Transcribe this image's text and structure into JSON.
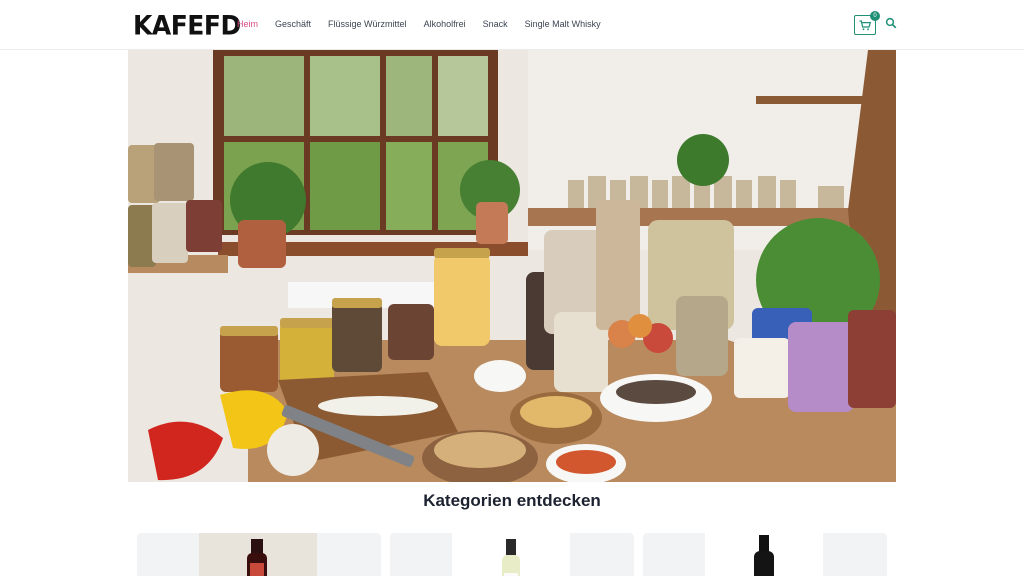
{
  "header": {
    "logo": "KAFEFD",
    "nav": [
      "Heim",
      "Geschäft",
      "Flüssige Würzmittel",
      "Alkoholfrei",
      "Snack",
      "Single Malt Whisky"
    ],
    "active_nav": "Heim",
    "cart_count": "0",
    "cart_icon": "shopping-cart-icon",
    "search_icon": "search-icon"
  },
  "hero": {
    "image": "kitchen-pantry-jars-photo"
  },
  "categories": {
    "title": "Kategorien entdecken",
    "cards": [
      {
        "image": "red-wine-bottle-photo"
      },
      {
        "image": "white-wine-bottle-photo"
      },
      {
        "image": "dark-wine-bottle-photo"
      }
    ]
  },
  "colors": {
    "accent": "#d94f8b",
    "brand_green": "#1f8f76",
    "text": "#2b2f3a"
  }
}
